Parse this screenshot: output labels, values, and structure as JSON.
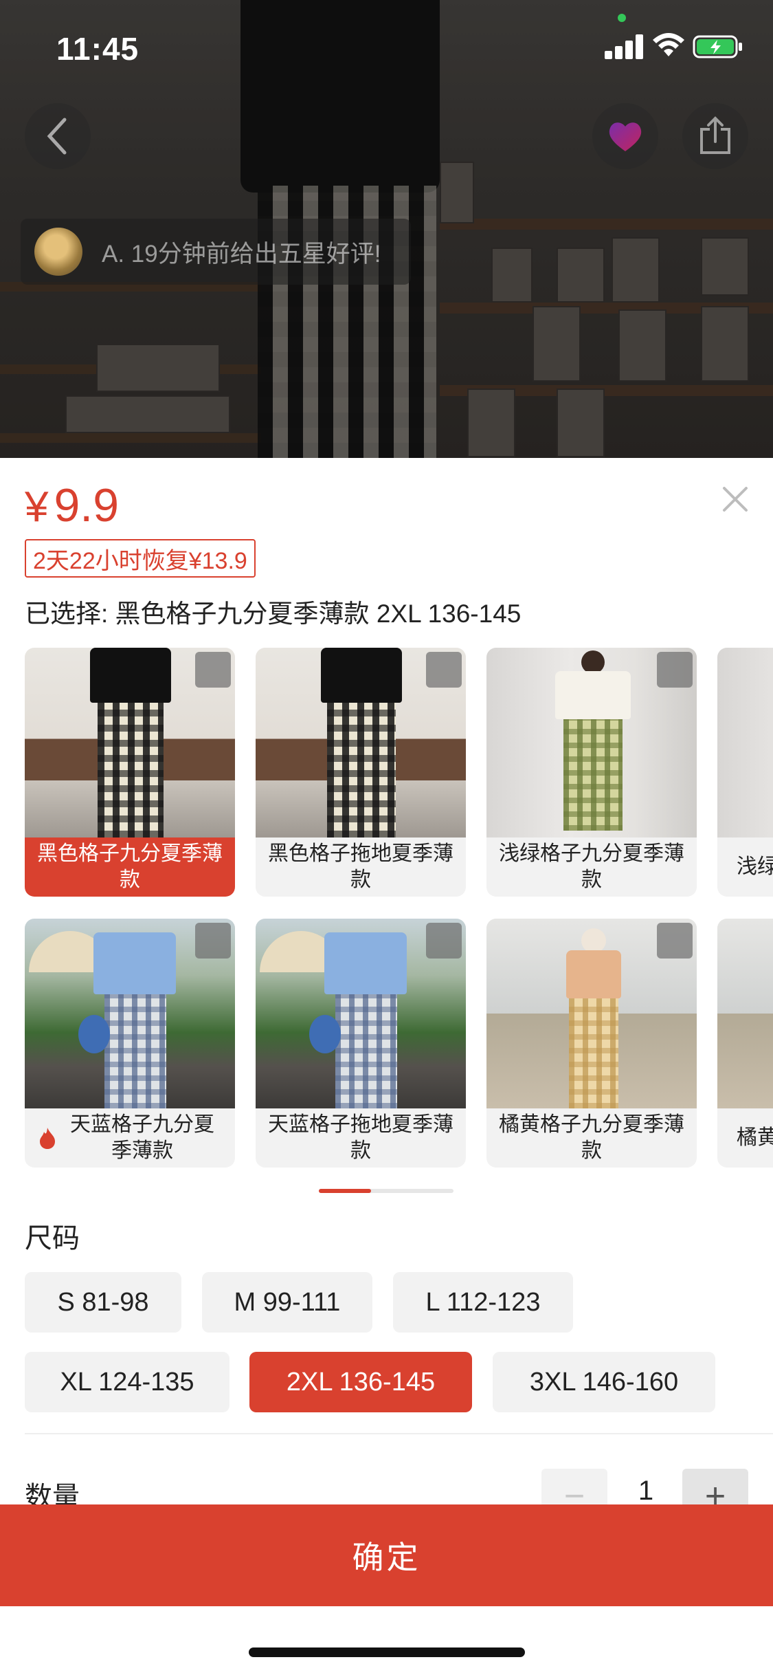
{
  "status_bar": {
    "time": "11:45"
  },
  "review_banner": {
    "text": "A. 19分钟前给出五星好评!"
  },
  "sheet": {
    "price": {
      "currency": "¥",
      "amount": "9.9"
    },
    "restore_tag": "2天22小时恢复¥13.9",
    "selected": "已选择: 黑色格子九分夏季薄款 2XL 136-145",
    "variants": [
      {
        "label": "黑色格子九分夏季薄款",
        "selected": true,
        "hot": false
      },
      {
        "label": "黑色格子拖地夏季薄款",
        "selected": false,
        "hot": false
      },
      {
        "label": "浅绿格子九分夏季薄款",
        "selected": false,
        "hot": false
      },
      {
        "label": "浅绿",
        "selected": false,
        "hot": false
      },
      {
        "label": "天蓝格子九分夏季薄款",
        "selected": false,
        "hot": true
      },
      {
        "label": "天蓝格子拖地夏季薄款",
        "selected": false,
        "hot": false
      },
      {
        "label": "橘黄格子九分夏季薄款",
        "selected": false,
        "hot": false
      },
      {
        "label": "橘黄",
        "selected": false,
        "hot": false
      }
    ],
    "size_title": "尺码",
    "sizes": [
      {
        "label": "S 81-98",
        "selected": false
      },
      {
        "label": "M 99-111",
        "selected": false
      },
      {
        "label": "L 112-123",
        "selected": false
      },
      {
        "label": "XL 124-135",
        "selected": false
      },
      {
        "label": "2XL 136-145",
        "selected": true
      },
      {
        "label": "3XL 146-160",
        "selected": false
      }
    ],
    "quantity": {
      "label": "数量",
      "minus": "−",
      "value": "1",
      "plus": "+"
    },
    "confirm": "确定"
  },
  "icons": {
    "back": "chevron-left-icon",
    "live": "live-icon",
    "share": "share-icon",
    "close": "close-icon",
    "expand": "expand-icon",
    "hot": "flame-icon"
  },
  "colors": {
    "accent": "#d9412f",
    "chip_bg": "#f2f2f2"
  }
}
